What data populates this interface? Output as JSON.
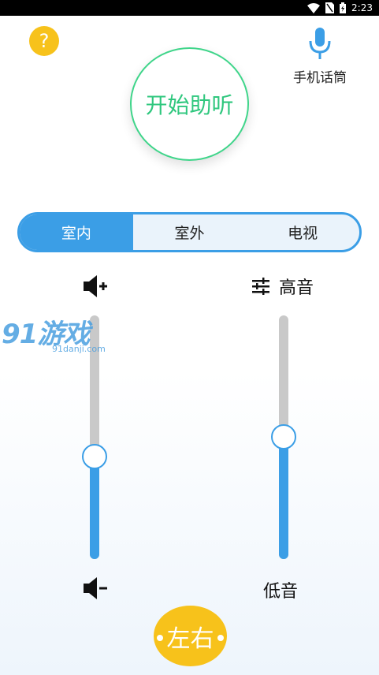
{
  "status_bar": {
    "time": "2:23"
  },
  "help": {
    "label": "?"
  },
  "mic": {
    "label": "手机话筒",
    "color": "#3b9ee6"
  },
  "start": {
    "label": "开始助听",
    "color": "#2fc77e"
  },
  "modes": [
    {
      "label": "室内",
      "active": true
    },
    {
      "label": "室外",
      "active": false
    },
    {
      "label": "电视",
      "active": false
    }
  ],
  "volume": {
    "level": 0.42,
    "up_icon": "volume-up-icon",
    "down_icon": "volume-down-icon"
  },
  "equalizer": {
    "high_label": "高音",
    "low_label": "低音",
    "level": 0.5,
    "icon": "equalizer-icon"
  },
  "watermark": {
    "main": "91游戏",
    "sub": "91danji.com"
  },
  "balance": {
    "label": "左右"
  },
  "colors": {
    "accent": "#3b9ee6",
    "yellow": "#f7c21b",
    "green": "#3fd58a"
  }
}
